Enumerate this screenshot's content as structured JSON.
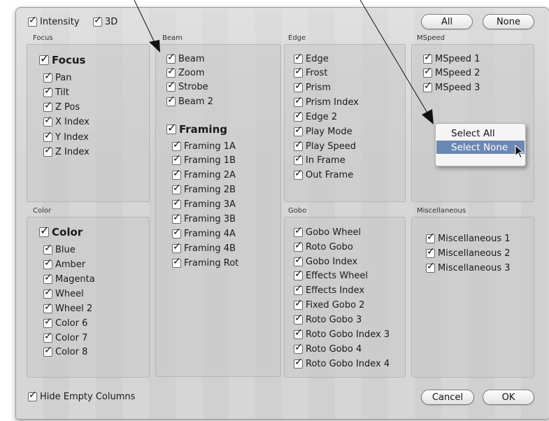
{
  "top_filters": [
    {
      "label": "Intensity",
      "checked": true
    },
    {
      "label": "3D",
      "checked": true
    }
  ],
  "top_buttons": {
    "all": "All",
    "none": "None"
  },
  "sections": {
    "focus": {
      "label": "Focus",
      "group_label": "Focus",
      "items": [
        "Pan",
        "Tilt",
        "Z Pos",
        "X Index",
        "Y Index",
        "Z Index"
      ]
    },
    "beam": {
      "label": "Beam",
      "items": [
        "Beam",
        "Zoom",
        "Strobe",
        "Beam 2"
      ],
      "framing_group_label": "Framing",
      "framing_items": [
        "Framing 1A",
        "Framing 1B",
        "Framing 2A",
        "Framing 2B",
        "Framing 3A",
        "Framing 3B",
        "Framing 4A",
        "Framing 4B",
        "Framing Rot"
      ]
    },
    "edge": {
      "label": "Edge",
      "items": [
        "Edge",
        "Frost",
        "Prism",
        "Prism Index",
        "Edge 2",
        "Play Mode",
        "Play Speed",
        "In Frame",
        "Out Frame"
      ]
    },
    "mspeed": {
      "label": "MSpeed",
      "items": [
        "MSpeed 1",
        "MSpeed 2",
        "MSpeed 3"
      ]
    },
    "color": {
      "label": "Color",
      "group_label": "Color",
      "items": [
        "Blue",
        "Amber",
        "Magenta",
        "Wheel",
        "Wheel 2",
        "Color 6",
        "Color 7",
        "Color 8"
      ]
    },
    "gobo": {
      "label": "Gobo",
      "items": [
        "Gobo Wheel",
        "Roto Gobo",
        "Gobo Index",
        "Effects Wheel",
        "Effects Index",
        "Fixed Gobo 2",
        "Roto Gobo 3",
        "Roto Gobo Index 3",
        "Roto Gobo 4",
        "Roto Gobo Index 4"
      ]
    },
    "misc": {
      "label": "Miscellaneous",
      "items": [
        "Miscellaneous 1",
        "Miscellaneous 2",
        "Miscellaneous 3"
      ]
    }
  },
  "context_menu": {
    "select_all": "Select All",
    "select_none": "Select None",
    "highlighted": "Select None"
  },
  "bottom": {
    "hide_empty_label": "Hide Empty Columns",
    "cancel": "Cancel",
    "ok": "OK"
  },
  "colors": {
    "menu_highlight": "#6b88b3",
    "dialog_bg": "#d4d4d4"
  }
}
